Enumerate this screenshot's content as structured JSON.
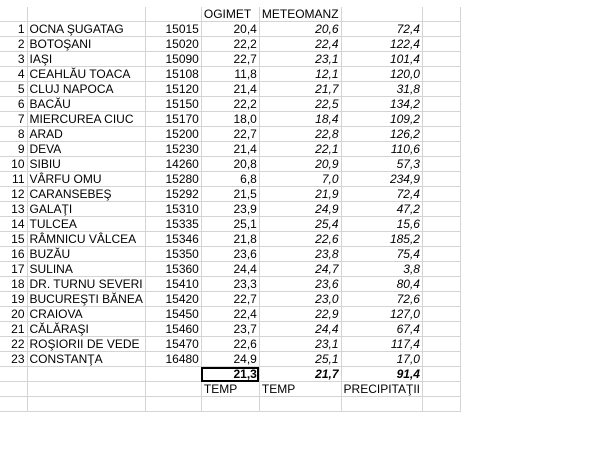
{
  "headers": {
    "ogimet": "OGIMET",
    "meteomanz": "METEOMANZ"
  },
  "colors": {
    "green": "#1f8f1f",
    "red": "#e01010",
    "blue": "#1a1acc",
    "grid": "#d4d4d4"
  },
  "rows": [
    [
      "1",
      "OCNA ŞUGATAG",
      "15015",
      "20,4",
      "20,6",
      "72,4"
    ],
    [
      "2",
      "BOTOŞANI",
      "15020",
      "22,2",
      "22,4",
      "122,4"
    ],
    [
      "3",
      "IAŞI",
      "15090",
      "22,7",
      "23,1",
      "101,4"
    ],
    [
      "4",
      "CEAHLĂU TOACA",
      "15108",
      "11,8",
      "12,1",
      "120,0"
    ],
    [
      "5",
      "CLUJ NAPOCA",
      "15120",
      "21,4",
      "21,7",
      "31,8"
    ],
    [
      "6",
      "BACĂU",
      "15150",
      "22,2",
      "22,5",
      "134,2"
    ],
    [
      "7",
      "MIERCUREA CIUC",
      "15170",
      "18,0",
      "18,4",
      "109,2"
    ],
    [
      "8",
      "ARAD",
      "15200",
      "22,7",
      "22,8",
      "126,2"
    ],
    [
      "9",
      "DEVA",
      "15230",
      "21,4",
      "22,1",
      "110,6"
    ],
    [
      "10",
      "SIBIU",
      "14260",
      "20,8",
      "20,9",
      "57,3"
    ],
    [
      "11",
      "VÂRFU OMU",
      "15280",
      "6,8",
      "7,0",
      "234,9"
    ],
    [
      "12",
      "CARANSEBEŞ",
      "15292",
      "21,5",
      "21,9",
      "72,4"
    ],
    [
      "13",
      "GALAŢI",
      "15310",
      "23,9",
      "24,9",
      "47,2"
    ],
    [
      "14",
      "TULCEA",
      "15335",
      "25,1",
      "25,4",
      "15,6"
    ],
    [
      "15",
      "RÂMNICU VÂLCEA",
      "15346",
      "21,8",
      "22,6",
      "185,2"
    ],
    [
      "16",
      "BUZĂU",
      "15350",
      "23,6",
      "23,8",
      "75,4"
    ],
    [
      "17",
      "SULINA",
      "15360",
      "24,4",
      "24,7",
      "3,8"
    ],
    [
      "18",
      "DR. TURNU SEVERI",
      "15410",
      "23,3",
      "23,6",
      "80,4"
    ],
    [
      "19",
      "BUCUREŞTI BĂNEA",
      "15420",
      "22,7",
      "23,0",
      "72,6"
    ],
    [
      "20",
      "CRAIOVA",
      "15450",
      "22,4",
      "22,9",
      "127,0"
    ],
    [
      "21",
      "CĂLĂRAŞI",
      "15460",
      "23,7",
      "24,4",
      "67,4"
    ],
    [
      "22",
      "ROŞIORII DE VEDE",
      "15470",
      "22,6",
      "23,1",
      "117,4"
    ],
    [
      "23",
      "CONSTANŢA",
      "16480",
      "24,9",
      "25,1",
      "17,0"
    ]
  ],
  "totals": {
    "ogimet_temp": "21,3",
    "meteomanz_temp": "21,7",
    "precipitation": "91,4"
  },
  "footer": {
    "temp1": "TEMP",
    "temp2": "TEMP",
    "precip": "PRECIPITAŢII"
  }
}
